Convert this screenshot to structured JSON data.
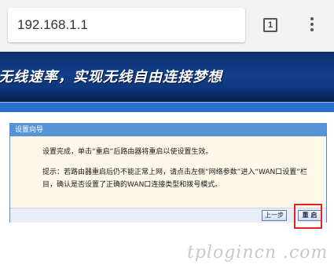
{
  "browser": {
    "url": "192.168.1.1",
    "tab_count": "1",
    "menu_icon": "more-vert-icon"
  },
  "banner": {
    "slogan": "无线速率，实现无线自由连接梦想"
  },
  "panel": {
    "title": "设置向导",
    "message_line1": "设置完成，单击“重启”后路由器将重启以使设置生效。",
    "message_line2": "提示：若路由器重启后仍不能正常上网，请点击左侧“网络参数”进入“WAN口设置”栏目，确认是否设置了正确的WAN口连接类型和拨号模式。",
    "prev_button": "上一步",
    "reboot_button": "重 启"
  },
  "watermark": "tplogincn .com",
  "colors": {
    "banner_bg": "#0a2f6e",
    "panel_header": "#5793d6",
    "panel_body": "#fff8e8",
    "highlight": "#e02424"
  }
}
